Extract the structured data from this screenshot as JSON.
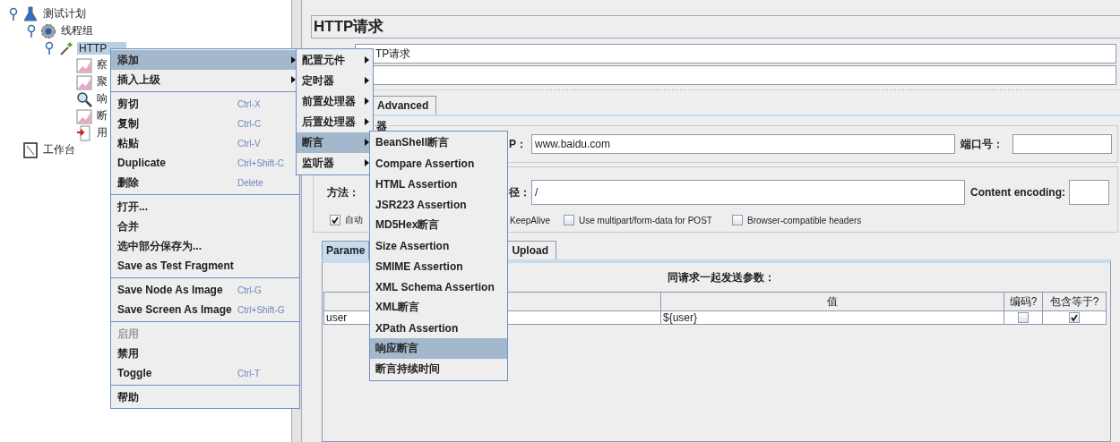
{
  "tree": [
    {
      "label": "测试计划",
      "kind": "plan",
      "expanded": true,
      "selected": false,
      "children": [
        {
          "label": "线程组",
          "kind": "threads",
          "expanded": true,
          "selected": false,
          "children": [
            {
              "label": "HTTP",
              "kind": "sampler",
              "expanded": true,
              "selected": true,
              "children": [
                {
                  "label": "察",
                  "kind": "chart",
                  "expanded": false,
                  "selected": false
                },
                {
                  "label": "聚",
                  "kind": "chart",
                  "expanded": false,
                  "selected": false
                },
                {
                  "label": "响",
                  "kind": "lens",
                  "expanded": false,
                  "selected": false
                },
                {
                  "label": "断",
                  "kind": "chart",
                  "expanded": false,
                  "selected": false
                },
                {
                  "label": "用",
                  "kind": "doc",
                  "expanded": false,
                  "selected": false
                }
              ]
            }
          ]
        }
      ]
    },
    {
      "label": "工作台",
      "kind": "workbench",
      "expanded": false,
      "selected": false
    }
  ],
  "panel": {
    "title": "HTTP请求",
    "name_value": "TP请求",
    "tabs": [
      {
        "label": "Advanced",
        "selected": false
      }
    ],
    "group_title": "器",
    "server_label": "P：",
    "server_value": "www.baidu.com",
    "port_label": "端口号：",
    "method_label": "方法：",
    "path_label": "径：",
    "path_value": "/",
    "encoding_label": "Content encoding:",
    "first_option": {
      "label": "自动",
      "checked": true
    },
    "keepalive_label": "KeepAlive",
    "options": [
      {
        "label": "Use multipart/form-data for POST",
        "checked": false
      },
      {
        "label": "Browser-compatible headers",
        "checked": false
      }
    ],
    "param_tabs": [
      {
        "label": "Parame",
        "selected": true
      },
      {
        "label": "Upload",
        "selected": false
      }
    ],
    "params": {
      "title": "同请求一起发送参数：",
      "columns": [
        "值",
        "编码?",
        "包含等于?"
      ],
      "rows": [
        {
          "name": "user",
          "value": "${user}",
          "encode": false,
          "include_equals": true
        }
      ]
    }
  },
  "context_menu": {
    "sections": [
      [
        {
          "label": "添加",
          "kind": "submenu",
          "selected": true,
          "disabled": false
        },
        {
          "label": "插入上级",
          "kind": "submenu",
          "selected": false,
          "disabled": false
        }
      ],
      [
        {
          "label": "剪切",
          "shortcut": "Ctrl-X",
          "kind": "action",
          "selected": false,
          "disabled": false
        },
        {
          "label": "复制",
          "shortcut": "Ctrl-C",
          "kind": "action",
          "selected": false,
          "disabled": false
        },
        {
          "label": "粘贴",
          "shortcut": "Ctrl-V",
          "kind": "action",
          "selected": false,
          "disabled": false
        },
        {
          "label": "Duplicate",
          "shortcut": "Ctrl+Shift-C",
          "kind": "action",
          "selected": false,
          "disabled": false
        },
        {
          "label": "删除",
          "shortcut": "Delete",
          "kind": "action",
          "selected": false,
          "disabled": false
        }
      ],
      [
        {
          "label": "打开...",
          "kind": "action",
          "selected": false,
          "disabled": false
        },
        {
          "label": "合并",
          "kind": "action",
          "selected": false,
          "disabled": false
        },
        {
          "label": "选中部分保存为...",
          "kind": "action",
          "selected": false,
          "disabled": false
        },
        {
          "label": "Save as Test Fragment",
          "kind": "action",
          "selected": false,
          "disabled": false
        }
      ],
      [
        {
          "label": "Save Node As Image",
          "shortcut": "Ctrl-G",
          "kind": "action",
          "selected": false,
          "disabled": false
        },
        {
          "label": "Save Screen As Image",
          "shortcut": "Ctrl+Shift-G",
          "kind": "action",
          "selected": false,
          "disabled": false
        }
      ],
      [
        {
          "label": "启用",
          "kind": "action",
          "selected": false,
          "disabled": true
        },
        {
          "label": "禁用",
          "kind": "action",
          "selected": false,
          "disabled": false
        },
        {
          "label": "Toggle",
          "shortcut": "Ctrl-T",
          "kind": "action",
          "selected": false,
          "disabled": false
        }
      ],
      [
        {
          "label": "帮助",
          "kind": "action",
          "selected": false,
          "disabled": false
        }
      ]
    ]
  },
  "add_menu": {
    "items": [
      {
        "label": "配置元件",
        "kind": "submenu",
        "selected": false
      },
      {
        "label": "定时器",
        "kind": "submenu",
        "selected": false
      },
      {
        "label": "前置处理器",
        "kind": "submenu",
        "selected": false
      },
      {
        "label": "后置处理器",
        "kind": "submenu",
        "selected": false
      },
      {
        "label": "断言",
        "kind": "submenu",
        "selected": true
      },
      {
        "label": "监听器",
        "kind": "submenu",
        "selected": false
      }
    ]
  },
  "assertion_menu": {
    "items": [
      {
        "label": "BeanShell断言",
        "selected": false
      },
      {
        "label": "Compare Assertion",
        "selected": false
      },
      {
        "label": "HTML Assertion",
        "selected": false
      },
      {
        "label": "JSR223 Assertion",
        "selected": false
      },
      {
        "label": "MD5Hex断言",
        "selected": false
      },
      {
        "label": "Size Assertion",
        "selected": false
      },
      {
        "label": "SMIME Assertion",
        "selected": false
      },
      {
        "label": "XML Schema Assertion",
        "selected": false
      },
      {
        "label": "XML断言",
        "selected": false
      },
      {
        "label": "XPath Assertion",
        "selected": false
      },
      {
        "label": "响应断言",
        "selected": true
      },
      {
        "label": "断言持续时间",
        "selected": false
      }
    ]
  }
}
